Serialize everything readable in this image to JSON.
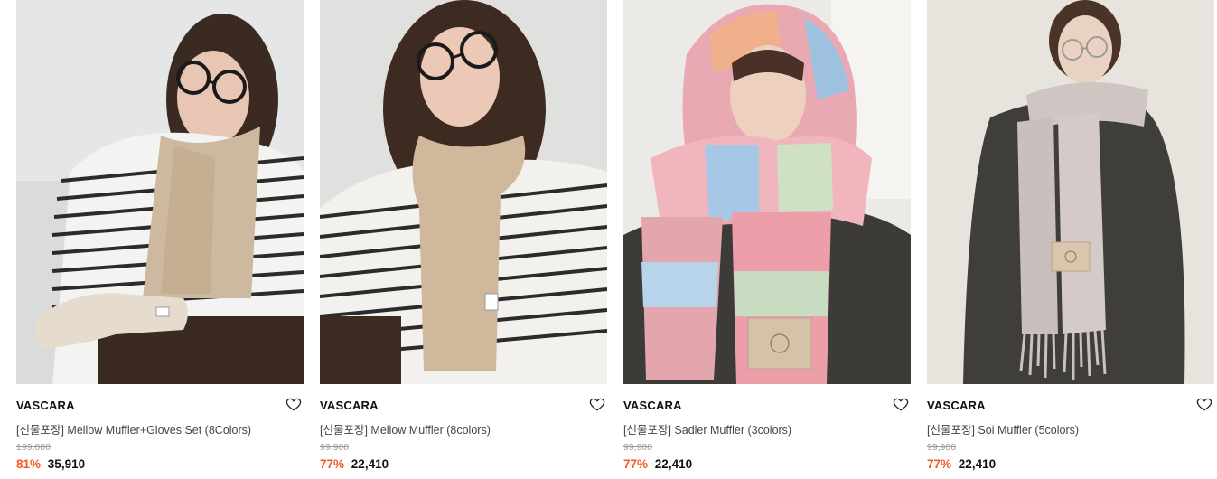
{
  "products": [
    {
      "brand": "VASCARA",
      "title": "[선물포장] Mellow Muffler+Gloves Set (8Colors)",
      "original_price": "199,000",
      "discount": "81%",
      "price": "35,910",
      "image": "model-in-striped-shirt-beige-scarf-gloves",
      "wishlist_icon": "heart-outline-icon"
    },
    {
      "brand": "VASCARA",
      "title": "[선물포장] Mellow Muffler (8colors)",
      "original_price": "99,900",
      "discount": "77%",
      "price": "22,410",
      "image": "model-in-striped-shirt-beige-scarf",
      "wishlist_icon": "heart-outline-icon"
    },
    {
      "brand": "VASCARA",
      "title": "[선물포장] Sadler Muffler (3colors)",
      "original_price": "99,900",
      "discount": "77%",
      "price": "22,410",
      "image": "model-wearing-pastel-check-scarf-as-hood",
      "wishlist_icon": "heart-outline-icon"
    },
    {
      "brand": "VASCARA",
      "title": "[선물포장] Soi Muffler (5colors)",
      "original_price": "99,900",
      "discount": "77%",
      "price": "22,410",
      "image": "model-in-dark-coat-grey-fringe-scarf",
      "wishlist_icon": "heart-outline-icon"
    }
  ],
  "colors": {
    "discount": "#f15b22",
    "original_price": "#9a9a9a",
    "text": "#111111"
  }
}
